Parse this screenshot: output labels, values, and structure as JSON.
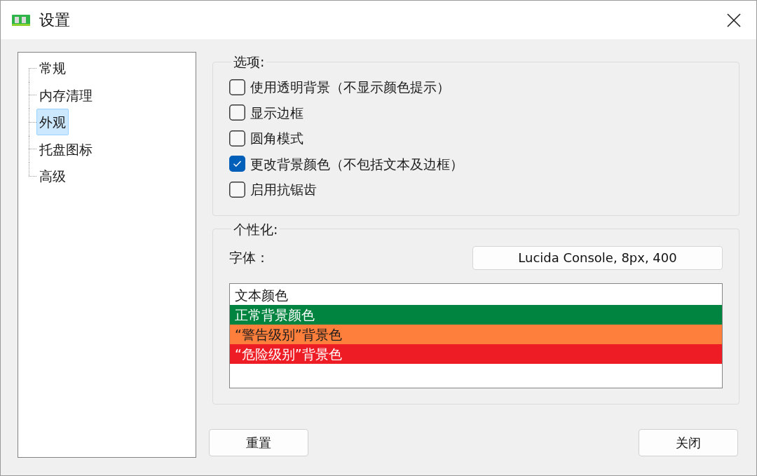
{
  "window": {
    "title": "设置"
  },
  "sidebar": {
    "items": [
      {
        "label": "常规",
        "selected": false
      },
      {
        "label": "内存清理",
        "selected": false
      },
      {
        "label": "外观",
        "selected": true
      },
      {
        "label": "托盘图标",
        "selected": false
      },
      {
        "label": "高级",
        "selected": false
      }
    ]
  },
  "options": {
    "title": "选项:",
    "checkboxes": [
      {
        "label": "使用透明背景（不显示颜色提示）",
        "checked": false
      },
      {
        "label": "显示边框",
        "checked": false
      },
      {
        "label": "圆角模式",
        "checked": false
      },
      {
        "label": "更改背景颜色（不包括文本及边框）",
        "checked": true
      },
      {
        "label": "启用抗锯齿",
        "checked": false
      }
    ]
  },
  "personalization": {
    "title": "个性化:",
    "font_label": "字体：",
    "font_button": "Lucida Console, 8px, 400",
    "color_list": [
      {
        "label": "文本颜色",
        "color": "#ffffff"
      },
      {
        "label": "正常背景颜色",
        "color": "#00843f"
      },
      {
        "label": "“警告级别”背景色",
        "color": "#fe7f3c"
      },
      {
        "label": "“危险级别”背景色",
        "color": "#ee1c24"
      }
    ]
  },
  "buttons": [
    {
      "label": "重置"
    },
    {
      "label": "关闭"
    }
  ]
}
